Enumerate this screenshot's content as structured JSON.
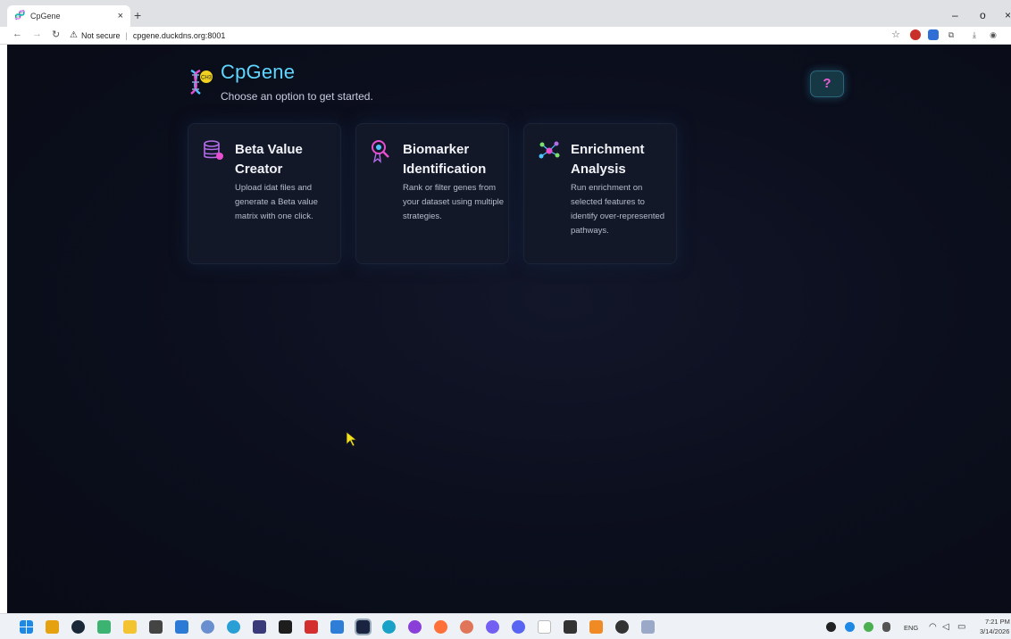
{
  "browser": {
    "tab_title": "CpGene",
    "tab_close": "×",
    "new_tab": "+",
    "security_label": "Not secure",
    "url": "cpgene.duckdns.org:8001",
    "win_min": "–",
    "win_max": "o",
    "win_close": "×"
  },
  "app": {
    "title": "CpGene",
    "subtitle": "Choose an option to get started.",
    "help_label": "?",
    "cards": [
      {
        "title_line1": "Beta Value",
        "title_line2": "Creator",
        "description": "Upload idat files and generate a Beta value matrix with one click.",
        "icon": "database-icon"
      },
      {
        "title_line1": "Biomarker",
        "title_line2": "Identification",
        "description": "Rank or filter genes from your dataset using multiple strategies.",
        "icon": "magnifier-ribbon-icon"
      },
      {
        "title_line1": "Enrichment",
        "title_line2": "Analysis",
        "description": "Run enrichment on selected features to identify over-represented pathways.",
        "icon": "network-icon"
      }
    ],
    "colors": {
      "background": "#0b0e1c",
      "title": "#5fd6ff",
      "card": "#121828",
      "help_question": "#ee5bd4"
    }
  },
  "taskbar": {
    "language": "ENG",
    "time": "7:21 PM",
    "date": "3/14/2026"
  }
}
